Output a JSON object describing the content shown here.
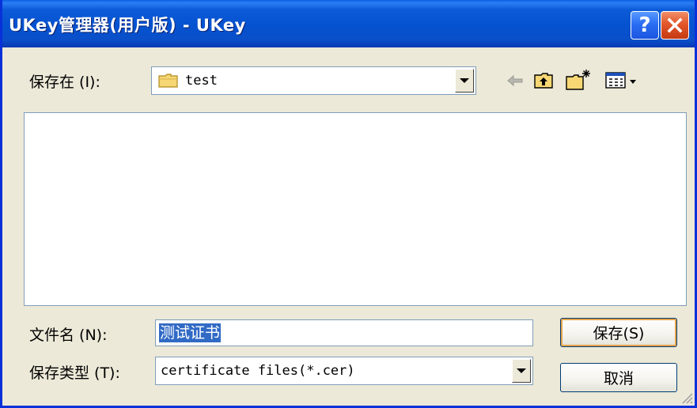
{
  "window": {
    "title": "UKey管理器(用户版) - UKey",
    "help_label": "?",
    "close_label": "✕"
  },
  "save_in": {
    "label": "保存在 (I):",
    "value": "test"
  },
  "toolbar": {
    "icons": [
      "back-arrow-icon",
      "up-folder-icon",
      "new-folder-icon",
      "view-menu-icon"
    ]
  },
  "file_name": {
    "label": "文件名 (N):",
    "value": "测试证书"
  },
  "file_type": {
    "label": "保存类型 (T):",
    "value": "certificate files(*.cer)"
  },
  "buttons": {
    "save_label": "保存(S)",
    "cancel_label": "取消"
  },
  "colors": {
    "titlebar": "#0552d0",
    "selection": "#316ac5",
    "close_button": "#e2562a",
    "dialog_bg": "#ece9d8"
  }
}
